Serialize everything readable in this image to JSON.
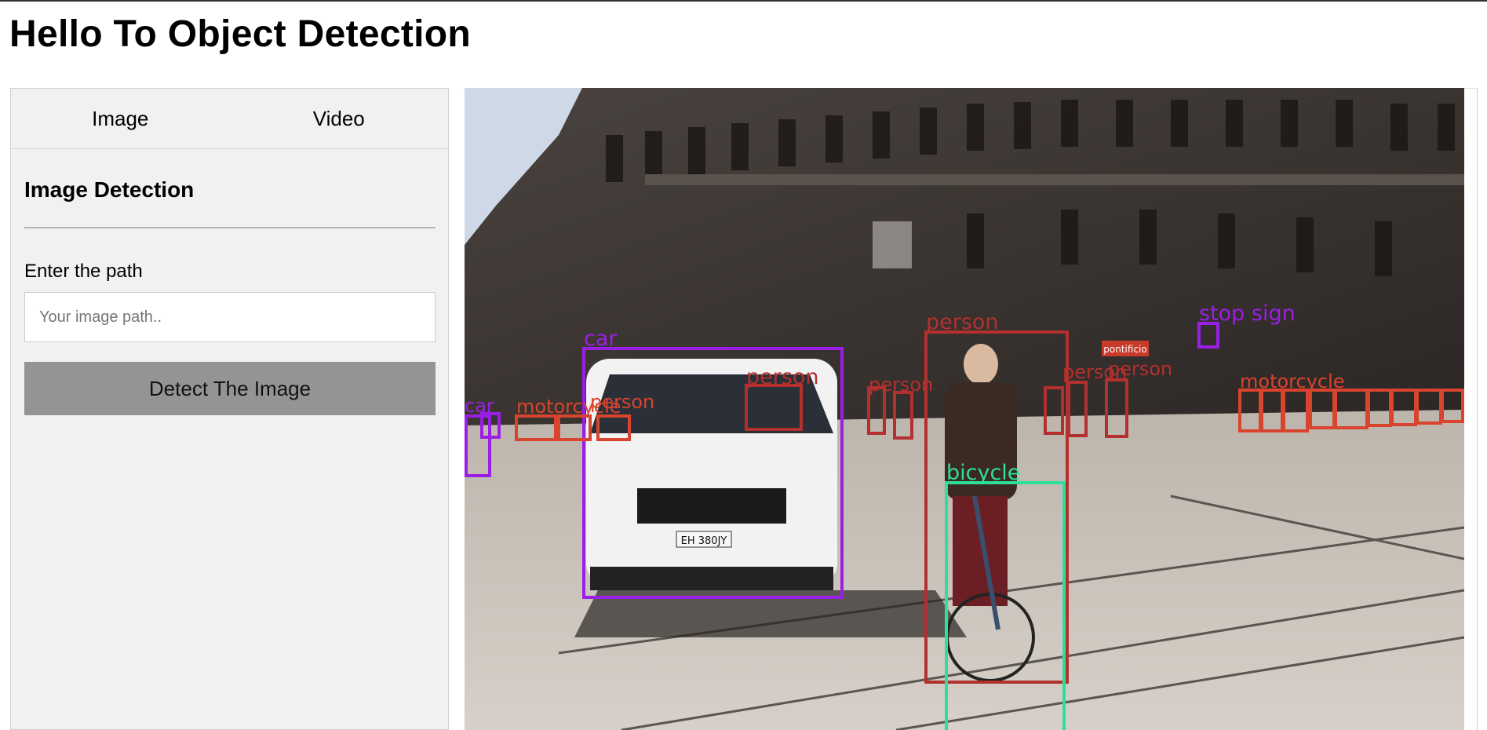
{
  "page": {
    "title": "Hello To Object Detection"
  },
  "tabs": [
    {
      "label": "Image"
    },
    {
      "label": "Video"
    }
  ],
  "panel": {
    "title": "Image Detection",
    "path_label": "Enter the path",
    "path_placeholder": "Your image path..",
    "path_value": "",
    "detect_button": "Detect The Image"
  },
  "colors": {
    "person": "#b3302e",
    "car": "#9b1ee6",
    "bicycle": "#2edf9a",
    "stop_sign": "#9b1ee6",
    "motorcycle": "#d8442e",
    "scene_sky": "#cfd8e6",
    "scene_ground": "#c9c2ba",
    "scene_building": "#3b3532"
  },
  "detections": [
    {
      "label": "car"
    },
    {
      "label": "person"
    },
    {
      "label": "person"
    },
    {
      "label": "bicycle"
    },
    {
      "label": "stop  sign"
    },
    {
      "label": "car"
    },
    {
      "label": "motorcycle"
    },
    {
      "label": "person"
    },
    {
      "label": "person"
    },
    {
      "label": "person"
    },
    {
      "label": "person"
    },
    {
      "label": "motorcycle"
    }
  ],
  "scene_text": {
    "plate": "EH 380JY",
    "shop_sign": "pontificio"
  }
}
